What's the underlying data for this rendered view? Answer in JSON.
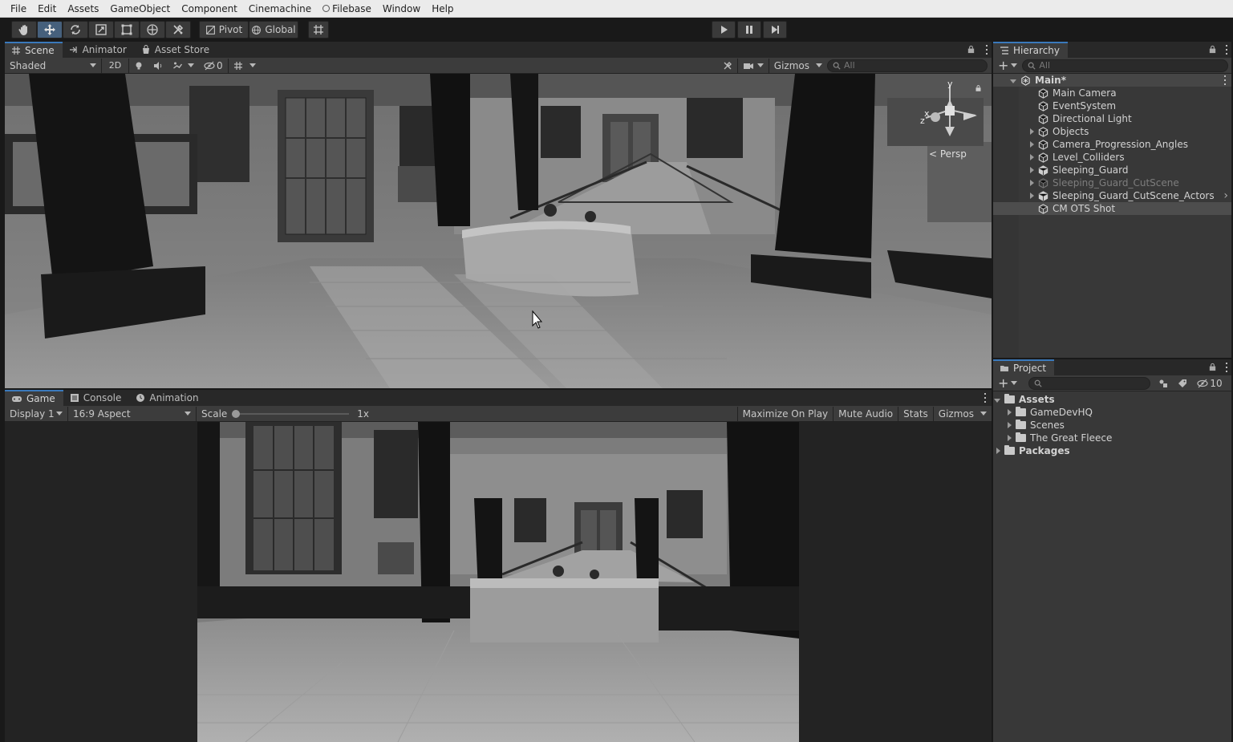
{
  "menu": [
    "File",
    "Edit",
    "Assets",
    "GameObject",
    "Component",
    "Cinemachine",
    "Filebase",
    "Window",
    "Help"
  ],
  "toolbar": {
    "pivot_label": "Pivot",
    "global_label": "Global"
  },
  "scene_panel": {
    "tabs": [
      "Scene",
      "Animator",
      "Asset Store"
    ],
    "shading_mode": "Shaded",
    "mode_2d": "2D",
    "hidden_count": "0",
    "gizmos_label": "Gizmos",
    "search_placeholder": "All",
    "gizmo_axes": {
      "y": "y",
      "x": "x",
      "z": "z"
    },
    "projection_label": "Persp"
  },
  "game_panel": {
    "tabs": [
      "Game",
      "Console",
      "Animation"
    ],
    "display": "Display 1",
    "aspect": "16:9 Aspect",
    "scale_label": "Scale",
    "scale_value": "1x",
    "maximize_label": "Maximize On Play",
    "mute_label": "Mute Audio",
    "stats_label": "Stats",
    "gizmos_label": "Gizmos"
  },
  "hierarchy": {
    "tab": "Hierarchy",
    "search_placeholder": "All",
    "scene_name": "Main*",
    "items": [
      {
        "label": "Main Camera",
        "expandable": false,
        "dim": false
      },
      {
        "label": "EventSystem",
        "expandable": false,
        "dim": false
      },
      {
        "label": "Directional Light",
        "expandable": false,
        "dim": false
      },
      {
        "label": "Objects",
        "expandable": true,
        "dim": false
      },
      {
        "label": "Camera_Progression_Angles",
        "expandable": true,
        "dim": false
      },
      {
        "label": "Level_Colliders",
        "expandable": true,
        "dim": false
      },
      {
        "label": "Sleeping_Guard",
        "expandable": true,
        "dim": false
      },
      {
        "label": "Sleeping_Guard_CutScene",
        "expandable": true,
        "dim": true
      },
      {
        "label": "Sleeping_Guard_CutScene_Actors",
        "expandable": true,
        "dim": false
      },
      {
        "label": "CM OTS Shot",
        "expandable": false,
        "dim": false,
        "selected": true
      }
    ]
  },
  "project": {
    "tab": "Project",
    "hidden_count": "10",
    "tree": [
      {
        "label": "Assets",
        "level": 0,
        "bold": true,
        "open": true
      },
      {
        "label": "GameDevHQ",
        "level": 1,
        "bold": false,
        "open": false
      },
      {
        "label": "Scenes",
        "level": 1,
        "bold": false,
        "open": false
      },
      {
        "label": "The Great Fleece",
        "level": 1,
        "bold": false,
        "open": false
      },
      {
        "label": "Packages",
        "level": 0,
        "bold": true,
        "open": false
      }
    ]
  }
}
